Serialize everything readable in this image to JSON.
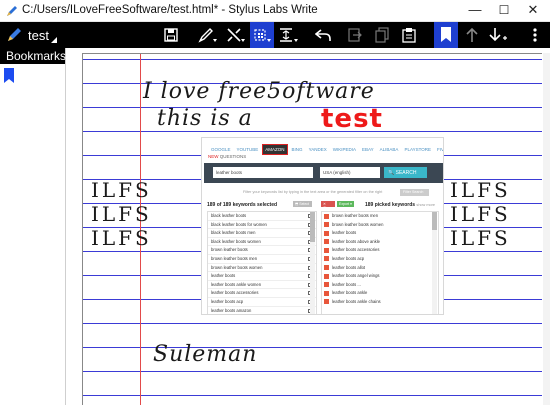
{
  "window": {
    "title": "C:/Users/ILoveFreeSoftware/test.html* - Stylus Labs Write",
    "minimize_icon": "—",
    "maximize_icon": "☐",
    "close_icon": "✕"
  },
  "toolbar": {
    "doc_name": "test"
  },
  "sidebar": {
    "header": "Bookmarks"
  },
  "handwriting": {
    "line1": "I love free5oftware",
    "line2_a": "this is a",
    "line2_b": "test",
    "ilfs": [
      "ILFS",
      "ILFS",
      "ILFS",
      "ILFS",
      "ILFS",
      "ILFS"
    ],
    "signature": "Suleman"
  },
  "embedded": {
    "tabs": [
      "GOOGLE",
      "YOUTUBE",
      "AMAZON",
      "BING",
      "YANDEX",
      "WIKIPEDIA",
      "EBAY",
      "ALIBABA",
      "PLAYSTORE",
      "FIVERR"
    ],
    "sub_new": "NEW",
    "sub_label": "QUESTIONS",
    "search_value": "leather boots",
    "region": "USA (english)",
    "search_button": "🔍 SEARCH",
    "hint": "Filter your keywords list by typing in the text area or the generated filter on the right",
    "filter_button": "Filter Search",
    "left_header": "189 of 189 keywords selected",
    "left_chip": "⬒ Select",
    "right_chip1": "✕ Clear",
    "right_chip2": "Export ▾",
    "right_header": "189 picked keywords",
    "right_header_sm": "show more",
    "left_rows": [
      "black leather boots",
      "black leather boots for women",
      "black leather boots men",
      "black leather boots women",
      "brown leather boots",
      "brown leather boots men",
      "brown leather boots women",
      "leather boots",
      "leather boots ankle women",
      "leather boots accessories",
      "leather boots acp",
      "leather boots amazon"
    ],
    "right_rows": [
      "brown leather boots men",
      "brown leather boots women",
      "leather boots",
      "leather boots above ankle",
      "leather boots accessories",
      "leather boots acp",
      "leather boots allot",
      "leather boots angel wings",
      "leather boots ...",
      "leather boots ankle",
      "leather boots ankle chains"
    ]
  }
}
